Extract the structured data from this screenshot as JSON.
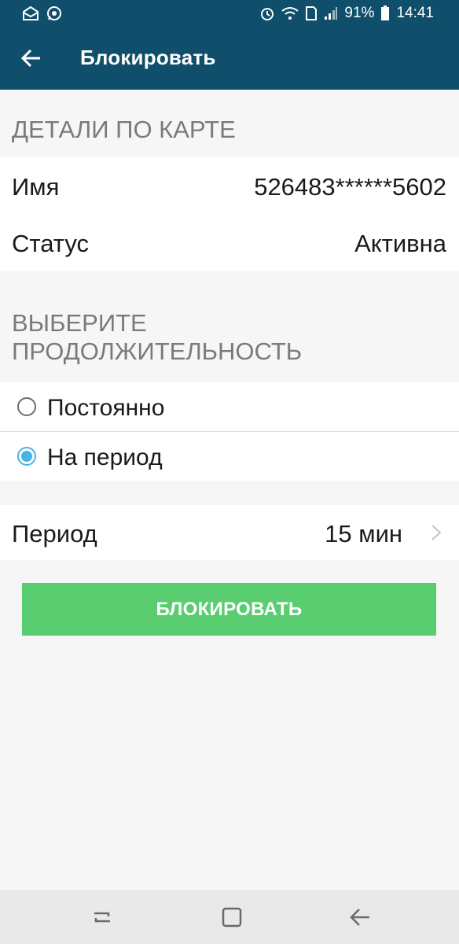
{
  "status_bar": {
    "battery": "91%",
    "time": "14:41",
    "left_icons": [
      "mail-icon",
      "whatsapp-icon"
    ],
    "right_icons": [
      "alarm-icon",
      "wifi-icon",
      "sim-icon",
      "signal-icon",
      "battery-icon"
    ]
  },
  "app_bar": {
    "title": "Блокировать",
    "back_icon": "arrow-back-icon",
    "background": "#0f4f6b"
  },
  "card_details": {
    "header": "ДЕТАЛИ ПО КАРТЕ",
    "name_label": "Имя",
    "name_value": "526483******5602",
    "status_label": "Статус",
    "status_value": "Активна"
  },
  "duration": {
    "header_line1": "ВЫБЕРИТЕ",
    "header_line2": "ПРОДОЛЖИТЕЛЬНОСТЬ",
    "options": [
      {
        "label": "Постоянно",
        "selected": false
      },
      {
        "label": "На период",
        "selected": true
      }
    ],
    "accent": "#45b3e6"
  },
  "period": {
    "label": "Период",
    "value": "15 мин",
    "icon": "chevron-right-icon"
  },
  "action": {
    "button_label": "БЛОКИРОВАТЬ",
    "color": "#5acd71"
  },
  "nav_bar": {
    "icons": [
      "recent-apps-icon",
      "home-icon",
      "back-icon"
    ]
  }
}
